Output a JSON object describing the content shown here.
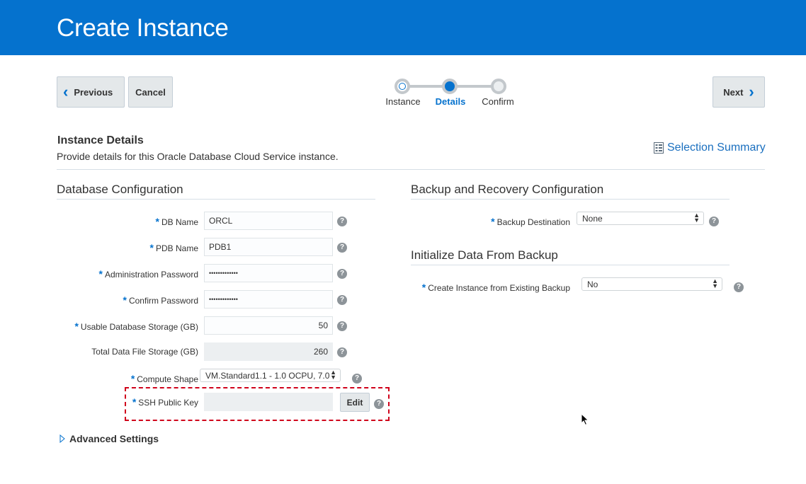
{
  "header": {
    "title": "Create Instance"
  },
  "nav": {
    "previous_label": "Previous",
    "cancel_label": "Cancel",
    "next_label": "Next"
  },
  "train": {
    "steps": [
      {
        "label": "Instance",
        "state": "visited"
      },
      {
        "label": "Details",
        "state": "current"
      },
      {
        "label": "Confirm",
        "state": "unvisited"
      }
    ]
  },
  "instance_details": {
    "title": "Instance Details",
    "description": "Provide details for this Oracle Database Cloud Service instance.",
    "selection_summary_label": "Selection Summary"
  },
  "db_config": {
    "title": "Database Configuration",
    "db_name": {
      "label": "DB Name",
      "value": "ORCL"
    },
    "pdb_name": {
      "label": "PDB Name",
      "value": "PDB1"
    },
    "admin_password": {
      "label": "Administration Password",
      "value": "•••••••••••••"
    },
    "confirm_password": {
      "label": "Confirm Password",
      "value": "•••••••••••••"
    },
    "usable_storage": {
      "label": "Usable Database Storage (GB)",
      "value": "50"
    },
    "total_storage": {
      "label": "Total Data File Storage (GB)",
      "value": "260"
    },
    "compute_shape": {
      "label": "Compute Shape",
      "value": "VM.Standard1.1 - 1.0 OCPU, 7.0"
    },
    "ssh_key": {
      "label": "SSH Public Key",
      "value": "",
      "edit_label": "Edit"
    }
  },
  "backup_config": {
    "title": "Backup and Recovery Configuration",
    "destination": {
      "label": "Backup Destination",
      "value": "None"
    }
  },
  "init_backup": {
    "title": "Initialize Data From Backup",
    "create_from_backup": {
      "label": "Create Instance from Existing Backup",
      "value": "No"
    }
  },
  "advanced": {
    "label": "Advanced Settings"
  },
  "colors": {
    "brand_blue": "#0572ce",
    "highlight_red": "#d0021b"
  },
  "help_symbol": "?",
  "required_symbol": "*"
}
